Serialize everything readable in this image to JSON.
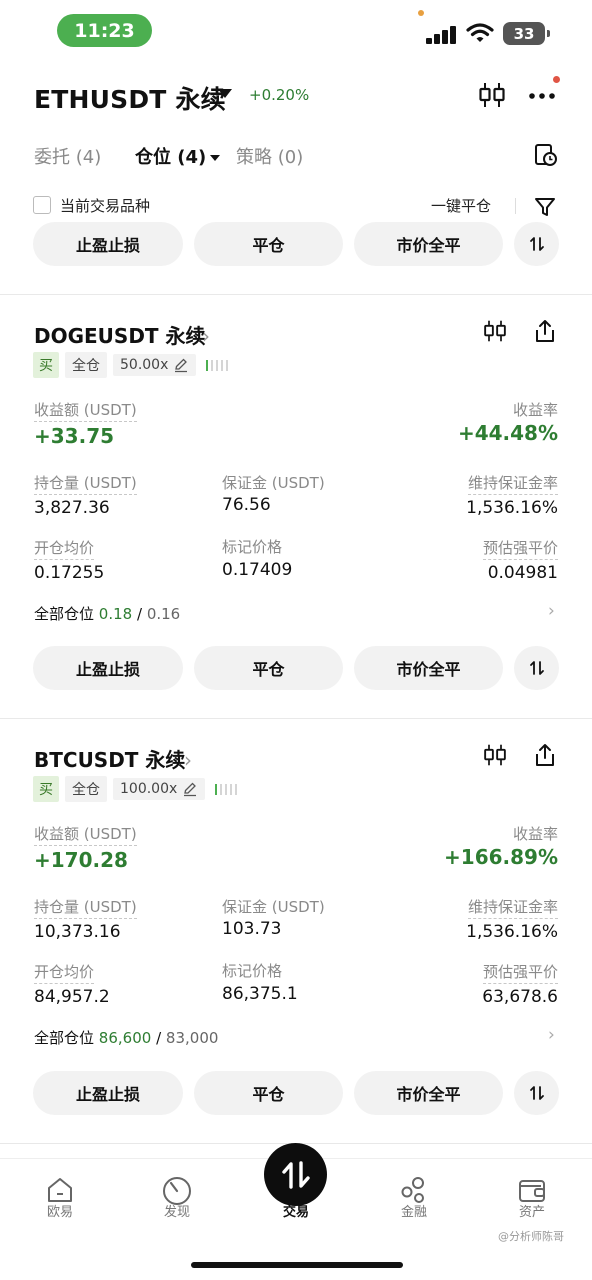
{
  "status_bar": {
    "time": "11:23",
    "battery": "33"
  },
  "header": {
    "pair": "ETHUSDT 永续",
    "change": "+0.20%"
  },
  "tabs": [
    {
      "label": "委托 (4)"
    },
    {
      "label": "仓位 (4)"
    },
    {
      "label": "策略 (0)"
    }
  ],
  "filter": {
    "current_symbol": "当前交易品种",
    "close_all": "一键平仓"
  },
  "actions": {
    "tp_sl": "止盈止损",
    "close": "平仓",
    "market_close_all": "市价全平"
  },
  "labels": {
    "pnl": "收益额 (USDT)",
    "roe": "收益率",
    "size": "持仓量 (USDT)",
    "margin": "保证金 (USDT)",
    "maint_ratio": "维持保证金率",
    "entry": "开仓均价",
    "mark": "标记价格",
    "liq": "预估强平价",
    "all_positions": "全部仓位"
  },
  "positions": [
    {
      "symbol": "DOGEUSDT 永续",
      "side": "买",
      "margin_mode": "全仓",
      "leverage": "50.00x",
      "pnl": "+33.75",
      "roe": "+44.48%",
      "size": "3,827.36",
      "margin": "76.56",
      "maint_ratio": "1,536.16%",
      "entry": "0.17255",
      "mark": "0.17409",
      "liq": "0.04981",
      "all_positions_a": "0.18",
      "all_positions_sep": "/",
      "all_positions_b": "0.16"
    },
    {
      "symbol": "BTCUSDT 永续",
      "side": "买",
      "margin_mode": "全仓",
      "leverage": "100.00x",
      "pnl": "+170.28",
      "roe": "+166.89%",
      "size": "10,373.16",
      "margin": "103.73",
      "maint_ratio": "1,536.16%",
      "entry": "84,957.2",
      "mark": "86,375.1",
      "liq": "63,678.6",
      "all_positions_a": "86,600",
      "all_positions_sep": "/",
      "all_positions_b": "83,000"
    }
  ],
  "bottom_nav": [
    {
      "label": "欧易",
      "icon": "home-icon"
    },
    {
      "label": "发现",
      "icon": "discover-icon"
    },
    {
      "label": "交易",
      "icon": "trade-icon"
    },
    {
      "label": "金融",
      "icon": "finance-icon"
    },
    {
      "label": "资产",
      "icon": "wallet-icon"
    }
  ],
  "watermark": "@分析师陈哥",
  "colors": {
    "positive": "#2e7d32",
    "status_pill": "#4caf50",
    "buy_tag_bg": "#e3f1db"
  }
}
